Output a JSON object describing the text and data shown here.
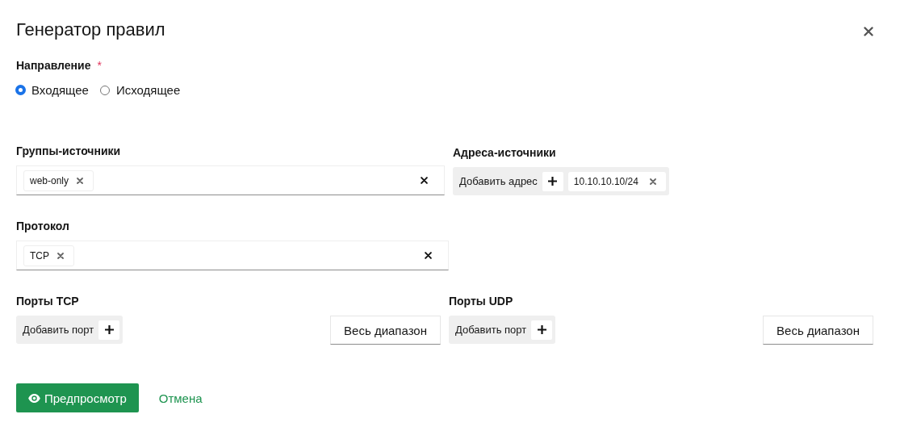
{
  "dialog": {
    "title": "Генератор правил"
  },
  "direction": {
    "label": "Направление",
    "required_mark": "*",
    "options": [
      {
        "label": "Входящее",
        "selected": true
      },
      {
        "label": "Исходящее",
        "selected": false
      }
    ]
  },
  "source_groups": {
    "label": "Группы-источники",
    "tags": [
      "web-only"
    ]
  },
  "source_addresses": {
    "label": "Адреса-источники",
    "add_label": "Добавить адрес",
    "tags": [
      "10.10.10.10/24"
    ]
  },
  "protocol": {
    "label": "Протокол",
    "tags": [
      "TCP"
    ]
  },
  "ports": [
    {
      "label": "Порты TCP",
      "add_label": "Добавить порт",
      "range_button": "Весь диапазон"
    },
    {
      "label": "Порты UDP",
      "add_label": "Добавить порт",
      "range_button": "Весь диапазон"
    }
  ],
  "actions": {
    "primary": "Предпросмотр",
    "cancel": "Отмена"
  }
}
